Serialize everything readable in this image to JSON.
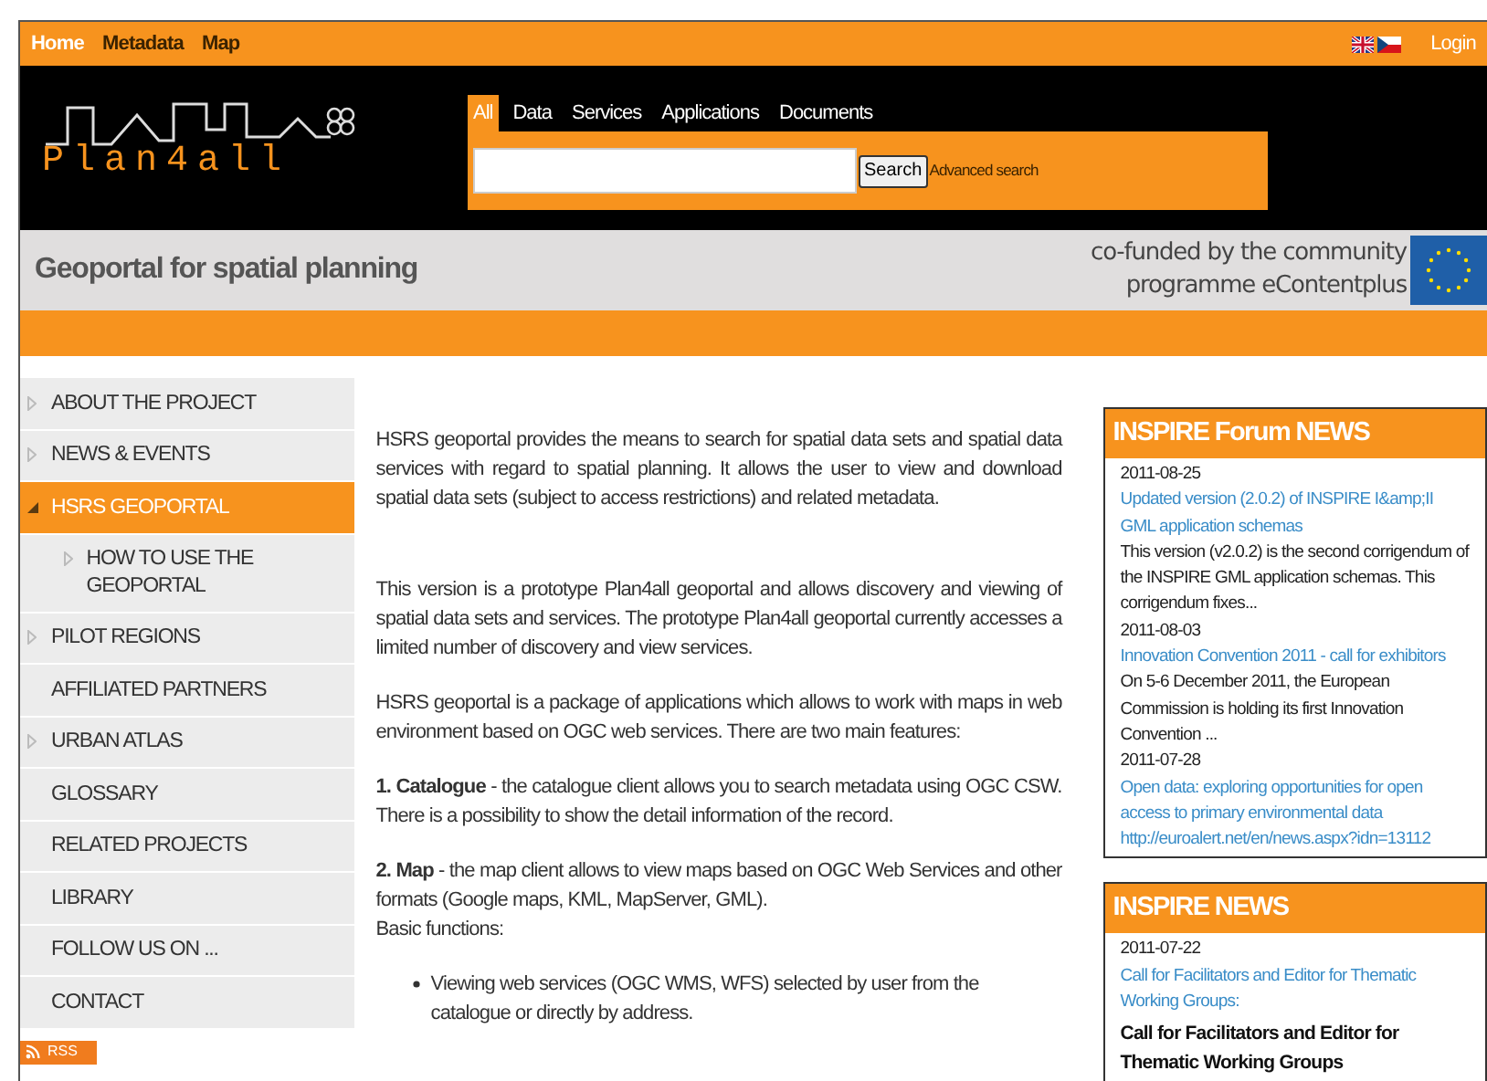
{
  "top_nav": {
    "links": [
      {
        "label": "Home",
        "selected": true
      },
      {
        "label": "Metadata",
        "selected": false
      },
      {
        "label": "Map",
        "selected": false
      }
    ],
    "login": "Login"
  },
  "logo": {
    "text": "Plan4all"
  },
  "search": {
    "tabs": [
      {
        "label": "All",
        "selected": true
      },
      {
        "label": "Data",
        "selected": false
      },
      {
        "label": "Services",
        "selected": false
      },
      {
        "label": "Applications",
        "selected": false
      },
      {
        "label": "Documents",
        "selected": false
      }
    ],
    "button": "Search",
    "advanced": "Advanced search"
  },
  "banner": {
    "title": "Geoportal for spatial planning",
    "funding_line_1": "co-funded by the community",
    "funding_line_2": "programme eContentplus"
  },
  "sidebar": {
    "items": [
      {
        "label": "ABOUT THE PROJECT",
        "expandable": true,
        "expanded": false,
        "selected": false
      },
      {
        "label": "NEWS & EVENTS",
        "expandable": true,
        "expanded": false,
        "selected": false
      },
      {
        "label": "HSRS GEOPORTAL",
        "expandable": true,
        "expanded": true,
        "selected": true,
        "children": [
          {
            "label": "HOW TO USE THE GEOPORTAL",
            "expandable": true,
            "expanded": false,
            "selected": false
          }
        ]
      },
      {
        "label": "PILOT REGIONS",
        "expandable": true,
        "expanded": false,
        "selected": false
      },
      {
        "label": "AFFILIATED PARTNERS",
        "expandable": false,
        "selected": false
      },
      {
        "label": "URBAN ATLAS",
        "expandable": true,
        "expanded": false,
        "selected": false
      },
      {
        "label": "GLOSSARY",
        "expandable": false,
        "selected": false
      },
      {
        "label": "RELATED PROJECTS",
        "expandable": false,
        "selected": false
      },
      {
        "label": "LIBRARY",
        "expandable": false,
        "selected": false
      },
      {
        "label": "FOLLOW US ON ...",
        "expandable": false,
        "selected": false
      },
      {
        "label": "CONTACT",
        "expandable": false,
        "selected": false
      }
    ],
    "rss": "RSS"
  },
  "content": {
    "blocks": [
      {
        "kind": "paragraph",
        "text": "HSRS geoportal provides the means to search for spatial data sets and spatial data services with regard to spatial planning. It allows the user to view and download spatial data sets (subject to access restrictions) and related metadata."
      },
      {
        "kind": "paragraph",
        "text": "This version is a prototype Plan4all geoportal and allows discovery and viewing of spatial data sets and services. The prototype Plan4all geoportal currently accesses a limited number of discovery and view services."
      },
      {
        "kind": "paragraph",
        "text": "HSRS geoportal is a package of applications which allows to work with maps in web environment based on OGC web services. There are two main features:"
      },
      {
        "kind": "paragraph",
        "text": "**1. Catalogue** - the catalogue client allows you to search metadata using OGC CSW. There is a possibility to show the detail information of the record."
      },
      {
        "kind": "paragraph",
        "text": "**2. Map** - the map client allows to view maps based on OGC Web Services and other formats (Google maps, KML, MapServer, GML).",
        "extra": "Basic functions:"
      },
      {
        "kind": "bullet",
        "text": "Viewing web services (OGC WMS, WFS) selected by user from the catalogue or directly by address."
      }
    ]
  },
  "news_boxes": [
    {
      "title": "INSPIRE Forum NEWS",
      "items": [
        {
          "date": "2011-08-25",
          "title": "Updated version (2.0.2) of INSPIRE I&amp;II GML application schemas",
          "summary": "This version (v2.0.2) is the second corrigendum of the INSPIRE GML application schemas. This corrigendum fixes..."
        },
        {
          "date": "2011-08-03",
          "title": "Innovation Convention 2011 - call for exhibitors",
          "summary": "On 5-6 December 2011, the European Commission is holding its first Innovation Convention ..."
        },
        {
          "date": "2011-07-28",
          "title": "Open data: exploring opportunities for open access to primary environmental data http://euroalert.net/en/news.aspx?idn=13112"
        }
      ]
    },
    {
      "title": "INSPIRE NEWS",
      "items": [
        {
          "date": "2011-07-22",
          "title": "Call for Facilitators and Editor for Thematic Working Groups:",
          "summary": "Call for Facilitators and Editor for Thematic Working Groups",
          "summary_bold": true
        }
      ]
    }
  ]
}
